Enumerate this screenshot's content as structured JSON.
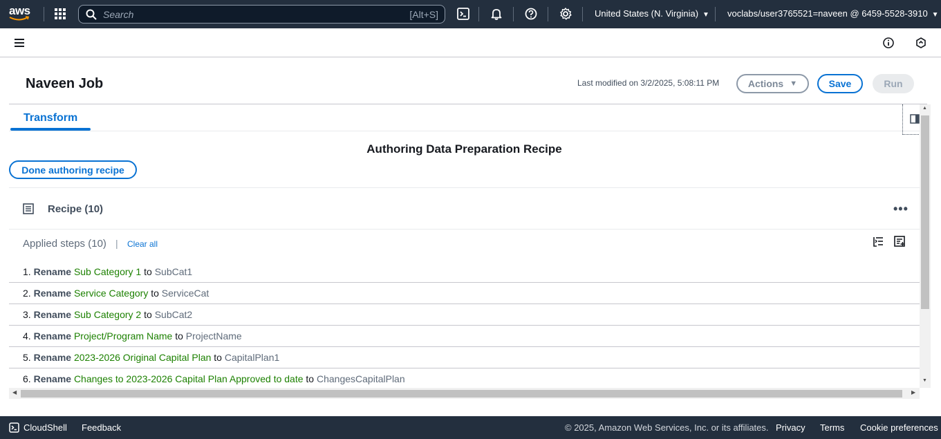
{
  "topbar": {
    "logo_text": "aws",
    "search_placeholder": "Search",
    "search_shortcut": "[Alt+S]",
    "region": "United States (N. Virginia)",
    "account": "voclabs/user3765521=naveen @ 6459-5528-3910"
  },
  "header": {
    "job_title": "Naveen Job",
    "last_modified": "Last modified on 3/2/2025, 5:08:11 PM",
    "actions_label": "Actions",
    "save_label": "Save",
    "run_label": "Run"
  },
  "tabs": [
    {
      "label": "Transform",
      "active": true
    }
  ],
  "authoring": {
    "heading": "Authoring Data Preparation Recipe",
    "done_button": "Done authoring recipe"
  },
  "recipe": {
    "title": "Recipe (10)",
    "applied_label": "Applied steps (10)",
    "separator": "|",
    "clear_all": "Clear all",
    "steps": [
      {
        "num": "1.",
        "verb": "Rename",
        "src": "Sub Category 1",
        "to": "to",
        "dst": "SubCat1"
      },
      {
        "num": "2.",
        "verb": "Rename",
        "src": "Service Category",
        "to": "to",
        "dst": "ServiceCat"
      },
      {
        "num": "3.",
        "verb": "Rename",
        "src": "Sub Category 2",
        "to": "to",
        "dst": "SubCat2"
      },
      {
        "num": "4.",
        "verb": "Rename",
        "src": "Project/Program Name",
        "to": "to",
        "dst": "ProjectName"
      },
      {
        "num": "5.",
        "verb": "Rename",
        "src": "2023-2026 Original Capital Plan",
        "to": "to",
        "dst": "CapitalPlan1"
      },
      {
        "num": "6.",
        "verb": "Rename",
        "src": "Changes to 2023-2026 Capital Plan Approved to date",
        "to": "to",
        "dst": "ChangesCapitalPlan"
      }
    ]
  },
  "footer": {
    "cloudshell": "CloudShell",
    "feedback": "Feedback",
    "copyright": "© 2025, Amazon Web Services, Inc. or its affiliates.",
    "privacy": "Privacy",
    "terms": "Terms",
    "cookie": "Cookie preferences"
  },
  "colors": {
    "nav_bg": "#232f3e",
    "accent": "#0972d3",
    "source_green": "#1d8102"
  }
}
